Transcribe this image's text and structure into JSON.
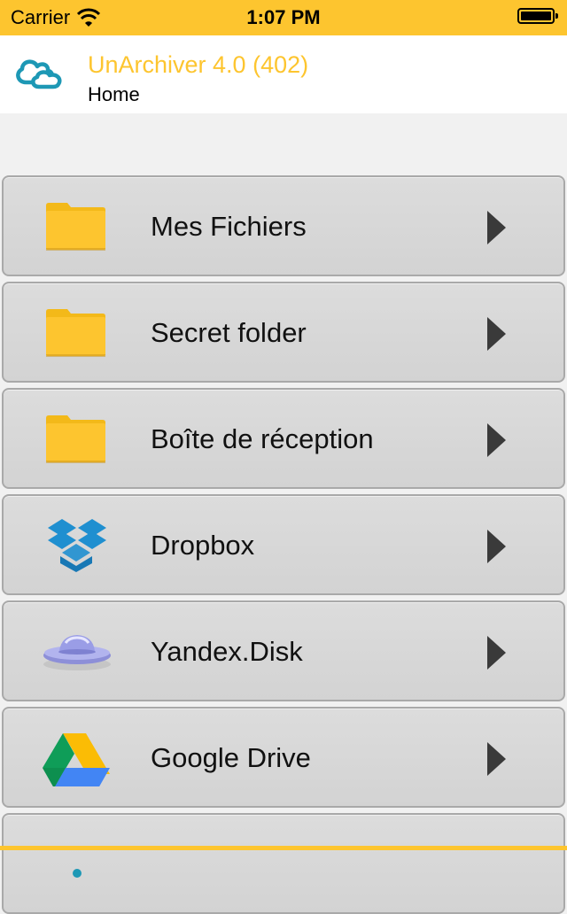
{
  "status_bar": {
    "carrier": "Carrier",
    "time": "1:07 PM",
    "icons": [
      "wifi-icon",
      "battery-icon"
    ]
  },
  "header": {
    "app_icon": "cloud-icon",
    "title": "UnArchiver 4.0 (402)",
    "subtitle": "Home"
  },
  "colors": {
    "accent": "#fdc52f",
    "row_bg": "#d8d8d8",
    "row_border": "#a9a9a9",
    "folder": "#fdc52f"
  },
  "items": [
    {
      "label": "Mes Fichiers",
      "icon": "folder-icon"
    },
    {
      "label": "Secret folder",
      "icon": "folder-icon"
    },
    {
      "label": "Boîte de réception",
      "icon": "folder-icon"
    },
    {
      "label": "Dropbox",
      "icon": "dropbox-icon"
    },
    {
      "label": "Yandex.Disk",
      "icon": "yandex-disk-icon"
    },
    {
      "label": "Google Drive",
      "icon": "google-drive-icon"
    },
    {
      "label": "",
      "icon": "partial-icon"
    }
  ]
}
